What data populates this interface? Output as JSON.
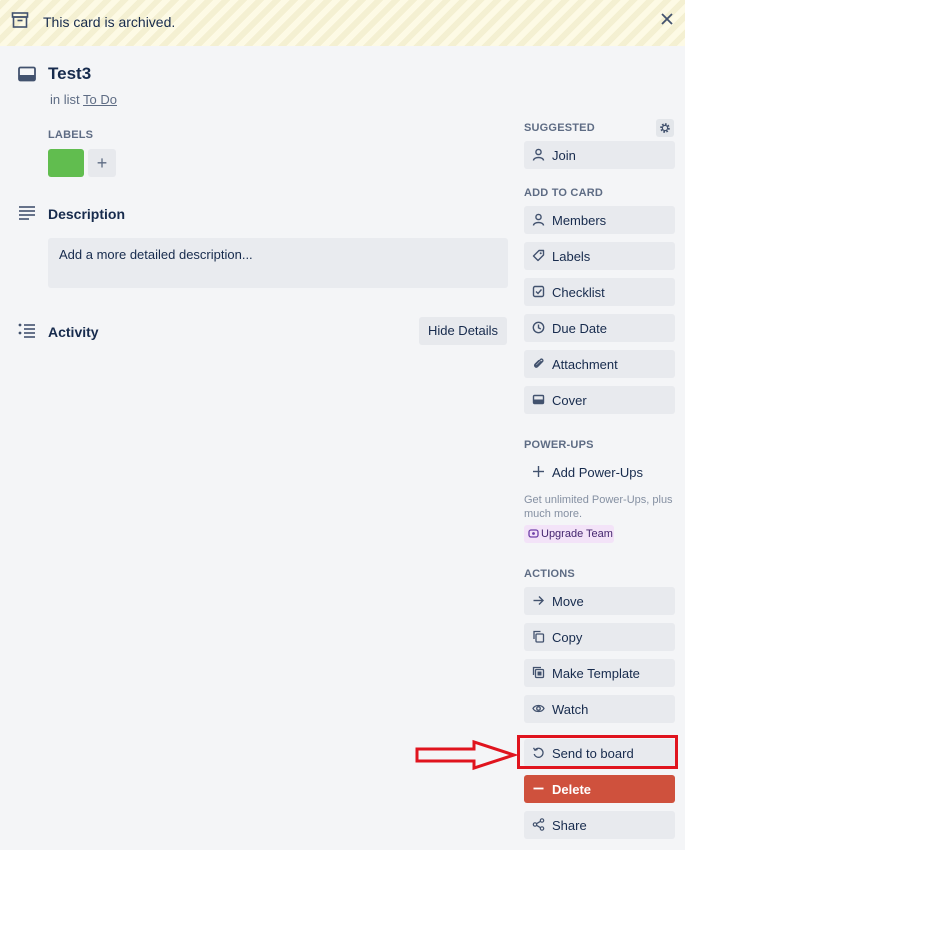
{
  "banner": {
    "text": "This card is archived."
  },
  "card": {
    "title": "Test3",
    "list_prefix": "in list",
    "list_name": "To Do",
    "labels_heading": "LABELS",
    "label_color": "#61bd4f",
    "add_label_symbol": "+",
    "description_heading": "Description",
    "description_placeholder": "Add a more detailed description...",
    "activity_heading": "Activity",
    "hide_details_label": "Hide Details"
  },
  "sidebar": {
    "suggested_heading": "SUGGESTED",
    "join_label": "Join",
    "add_to_card_heading": "ADD TO CARD",
    "add_to_card": [
      "Members",
      "Labels",
      "Checklist",
      "Due Date",
      "Attachment",
      "Cover"
    ],
    "powerups_heading": "POWER-UPS",
    "add_powerups_label": "Add Power-Ups",
    "upsell_text": "Get unlimited Power-Ups, plus much more.",
    "upgrade_label": "Upgrade Team",
    "actions_heading": "ACTIONS",
    "actions": [
      "Move",
      "Copy",
      "Make Template",
      "Watch",
      "Send to board",
      "Delete",
      "Share"
    ]
  },
  "colors": {
    "background": "#f4f5f7",
    "button": "#e8eaee",
    "delete": "#cf513d",
    "annotation": "#e0141e"
  },
  "icons": {
    "banner": "archive-icon",
    "close": "close-icon",
    "title": "card-icon",
    "description": "description-icon",
    "activity": "activity-icon",
    "settings": "gear-icon",
    "add_to_card": [
      "person-icon",
      "tag-icon",
      "checklist-icon",
      "clock-icon",
      "paperclip-icon",
      "cover-icon"
    ],
    "actions": [
      "arrow-right-icon",
      "copy-icon",
      "template-icon",
      "eye-icon",
      "restore-icon",
      "minus-icon",
      "share-icon"
    ]
  }
}
